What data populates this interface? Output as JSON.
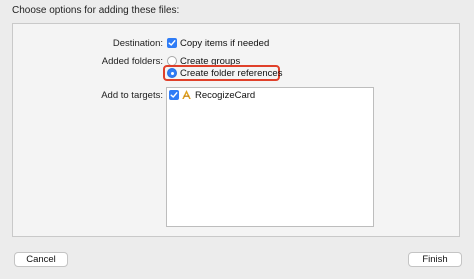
{
  "header": {
    "title": "Choose options for adding these files:"
  },
  "options": {
    "destination_label": "Destination:",
    "destination_checkbox_label": "Copy items if needed",
    "destination_checked": true,
    "added_folders_label": "Added folders:",
    "added_folders_options": [
      {
        "label": "Create groups",
        "selected": false
      },
      {
        "label": "Create folder references",
        "selected": true
      }
    ],
    "add_to_targets_label": "Add to targets:",
    "targets": [
      {
        "name": "RecogizeCard",
        "checked": true,
        "icon": "app-target-icon"
      }
    ]
  },
  "footer": {
    "cancel_label": "Cancel",
    "finish_label": "Finish"
  },
  "colors": {
    "accent": "#2f7cf6",
    "highlight": "#e0402a",
    "background": "#ececec",
    "panel": "#f4f4f4"
  }
}
